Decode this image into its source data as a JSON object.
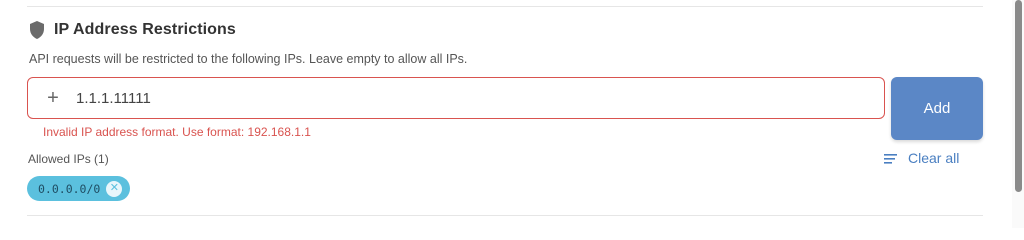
{
  "section": {
    "title": "IP Address Restrictions",
    "description": "API requests will be restricted to the following IPs. Leave empty to allow all IPs.",
    "icon": "shield-icon"
  },
  "ip_input": {
    "value": "1.1.1.11111",
    "icon": "plus-icon"
  },
  "add_button": {
    "label": "Add",
    "color": "#5b87c6"
  },
  "error": {
    "message": "Invalid IP address format. Use format: 192.168.1.1",
    "color": "#d9534f"
  },
  "allowed": {
    "label": "Allowed IPs (1)",
    "clear_all_label": "Clear all",
    "clear_icon": "clear-list-icon",
    "ips": [
      "0.0.0.0/0"
    ]
  },
  "colors": {
    "chip_bg": "#5bc0de",
    "link": "#4a7fc1"
  }
}
